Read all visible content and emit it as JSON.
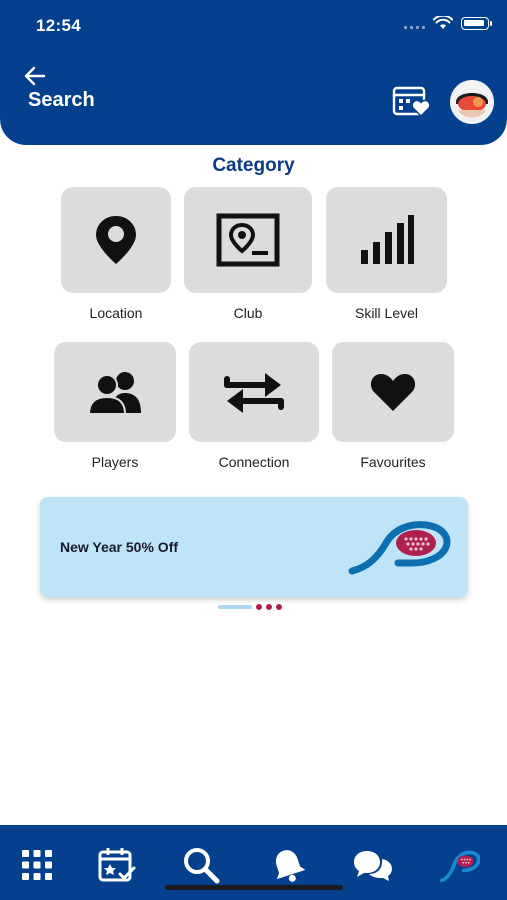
{
  "status_bar": {
    "time": "12:54"
  },
  "header": {
    "title": "Search"
  },
  "category": {
    "title": "Category",
    "items": [
      {
        "label": "Location",
        "icon": "location-pin-icon"
      },
      {
        "label": "Club",
        "icon": "club-map-icon"
      },
      {
        "label": "Skill Level",
        "icon": "signal-bars-icon"
      },
      {
        "label": "Players",
        "icon": "players-icon"
      },
      {
        "label": "Connection",
        "icon": "connection-arrows-icon"
      },
      {
        "label": "Favourites",
        "icon": "heart-icon"
      }
    ]
  },
  "banner": {
    "text": "New Year 50% Off",
    "logo": "padel-logo"
  },
  "pager": {
    "active_index": 0,
    "total": 4
  },
  "tabbar": {
    "items": [
      "grid-icon",
      "calendar-check-icon",
      "search-icon",
      "bell-icon",
      "chat-icon",
      "padel-logo-icon"
    ]
  },
  "colors": {
    "primary": "#05408f",
    "tile": "#dcdcdc",
    "banner": "#bfe3f7",
    "accent": "#b0204f"
  }
}
